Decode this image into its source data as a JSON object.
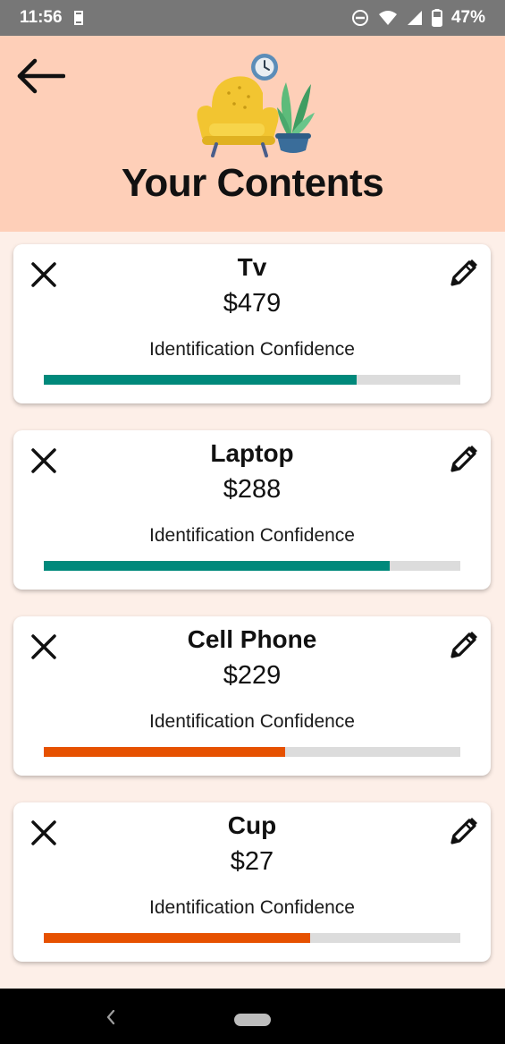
{
  "status_bar": {
    "time": "11:56",
    "battery": "47%"
  },
  "header": {
    "title": "Your Contents"
  },
  "items": [
    {
      "name": "Tv",
      "price": "$479",
      "confidence_label": "Identification Confidence",
      "confidence": 0.75,
      "bar_color": "#00897b"
    },
    {
      "name": "Laptop",
      "price": "$288",
      "confidence_label": "Identification Confidence",
      "confidence": 0.83,
      "bar_color": "#00897b"
    },
    {
      "name": "Cell Phone",
      "price": "$229",
      "confidence_label": "Identification Confidence",
      "confidence": 0.58,
      "bar_color": "#e65100"
    },
    {
      "name": "Cup",
      "price": "$27",
      "confidence_label": "Identification Confidence",
      "confidence": 0.64,
      "bar_color": "#e65100"
    }
  ],
  "colors": {
    "header_bg": "#fecfb8",
    "page_bg": "#fdefe8",
    "track": "#dcdcdc"
  },
  "icons": {
    "back": "arrow-left-icon",
    "delete": "close-icon",
    "edit": "pencil-icon",
    "illustration": "armchair-plant-clock-illustration"
  }
}
